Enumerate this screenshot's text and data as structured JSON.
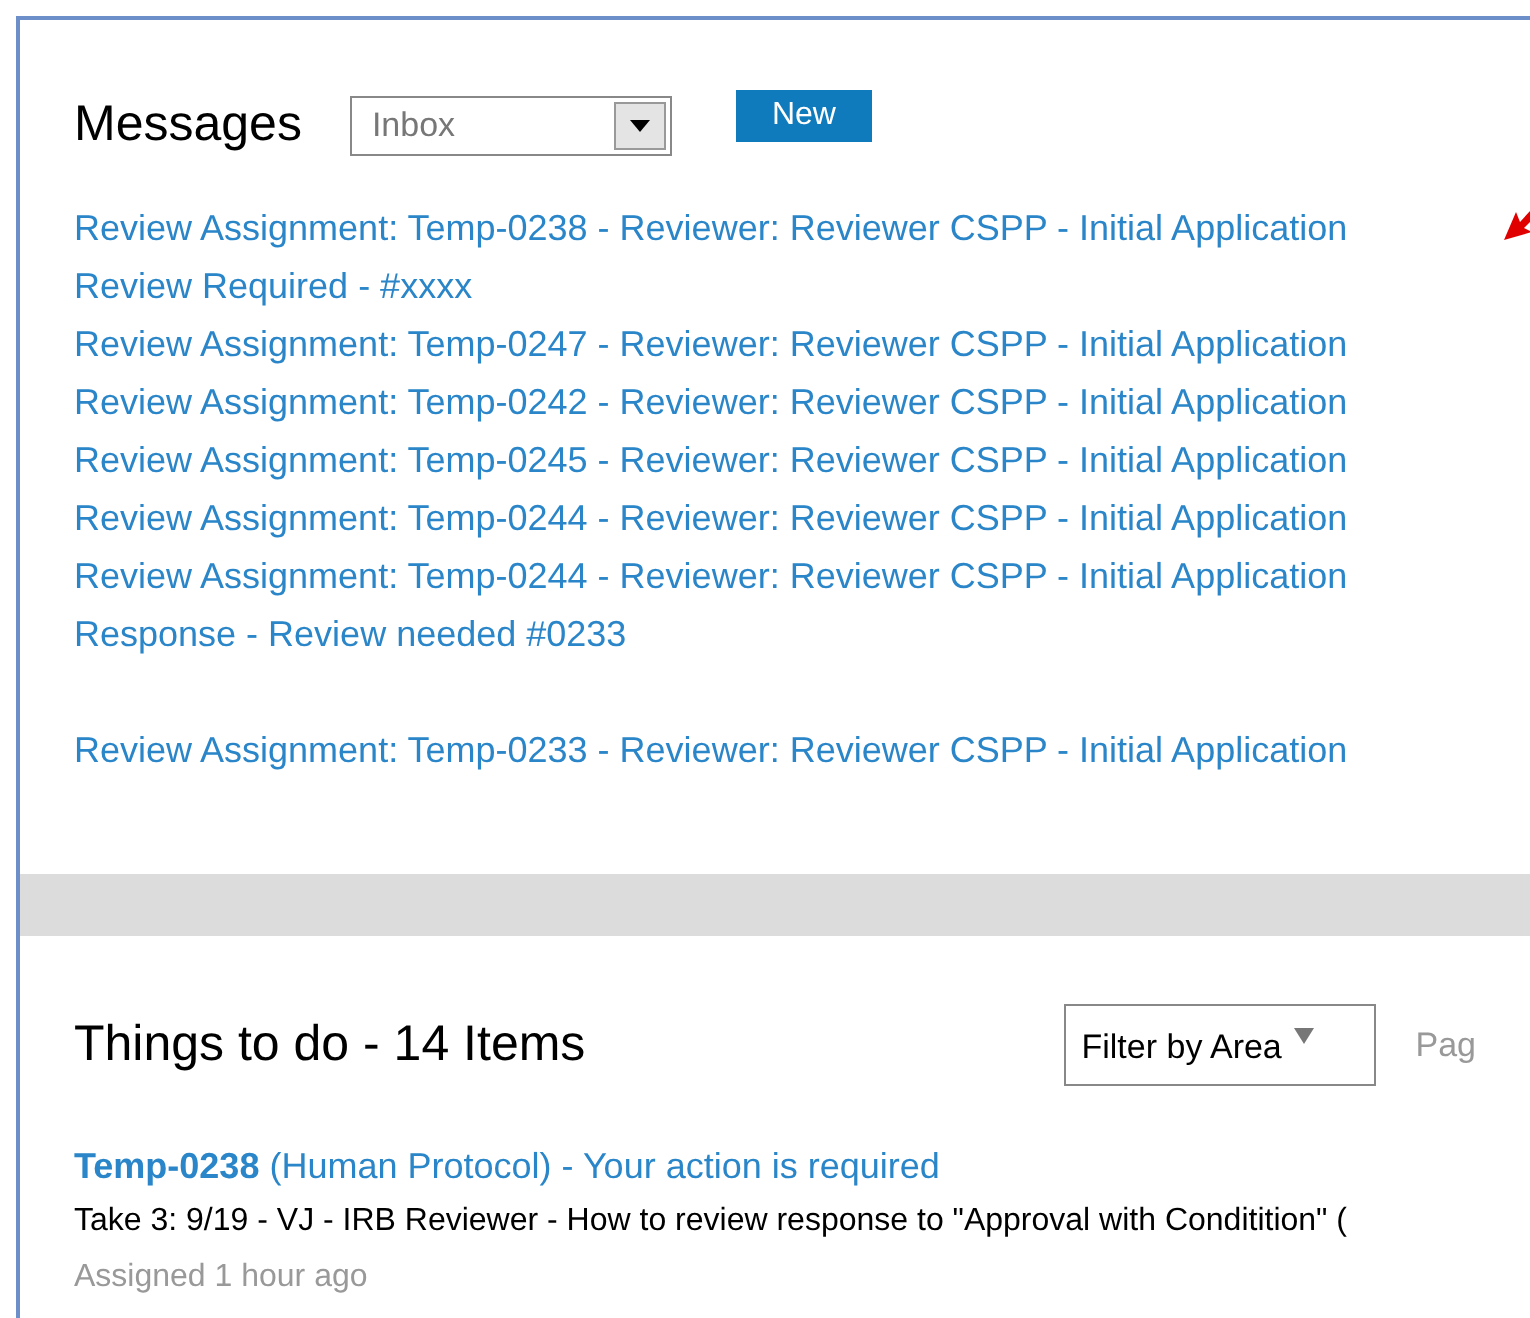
{
  "messages": {
    "title": "Messages",
    "folder": {
      "value": "Inbox"
    },
    "new_button": "New",
    "groups": [
      {
        "items": [
          "Review Assignment: Temp-0238 - Reviewer: Reviewer CSPP - Initial Application",
          "Review Required - #xxxx",
          "Review Assignment: Temp-0247 - Reviewer: Reviewer CSPP - Initial Application",
          "Review Assignment: Temp-0242 - Reviewer: Reviewer CSPP - Initial Application",
          "Review Assignment: Temp-0245 - Reviewer: Reviewer CSPP - Initial Application",
          "Review Assignment: Temp-0244 - Reviewer: Reviewer CSPP - Initial Application",
          "Review Assignment: Temp-0244 - Reviewer: Reviewer CSPP - Initial Application",
          "Response - Review needed #0233"
        ]
      },
      {
        "items": [
          "Review Assignment: Temp-0233 - Reviewer: Reviewer CSPP - Initial Application"
        ]
      }
    ]
  },
  "todo": {
    "title": "Things to do - 14 Items",
    "filter": "Filter by Area",
    "pager": "Pag",
    "items": [
      {
        "id": "Temp-0238",
        "type": "(Human Protocol) - Your action is required",
        "description": "Take 3: 9/19 - VJ - IRB Reviewer - How to review response to \"Approval with Conditition\" (",
        "assigned": "Assigned 1 hour ago"
      }
    ]
  }
}
